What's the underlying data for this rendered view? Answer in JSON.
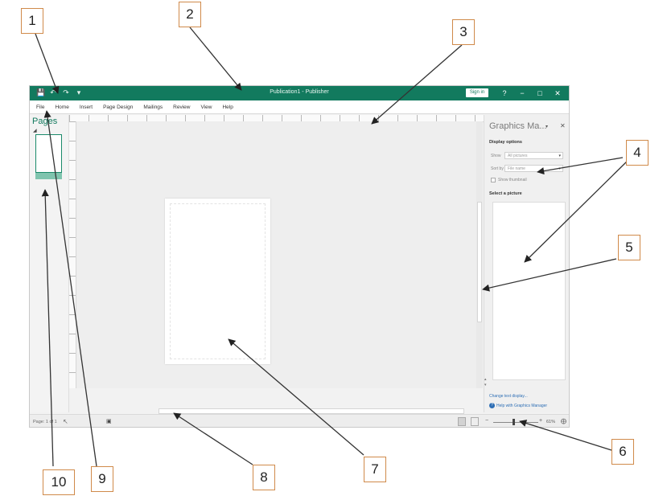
{
  "window": {
    "title": "Publication1 - Publisher",
    "sign_in": "Sign in",
    "controls": [
      "?",
      "−",
      "□",
      "✕"
    ]
  },
  "menu": [
    "File",
    "Home",
    "Insert",
    "Page Design",
    "Mailings",
    "Review",
    "View",
    "Help"
  ],
  "pages_pane": {
    "title": "Pages"
  },
  "graphics_pane": {
    "title": "Graphics Ma...",
    "display_options": "Display options",
    "show_label": "Show",
    "show_value": "All pictures",
    "sort_label": "Sort by",
    "sort_value": "File name",
    "thumbnail_label": "Show thumbnail",
    "select_picture": "Select a picture",
    "link_1": "Change text display...",
    "link_2": "Help with Graphics Manager"
  },
  "status": {
    "page": "Page: 1 of 1",
    "zoom": "61%",
    "zoom_fraction": 0.45
  },
  "callouts": [
    "1",
    "2",
    "3",
    "4",
    "5",
    "6",
    "7",
    "8",
    "9",
    "10"
  ],
  "colors": {
    "title_bar": "#127a5e",
    "accent": "#127a5e",
    "callout_border": "#d08a4a"
  }
}
